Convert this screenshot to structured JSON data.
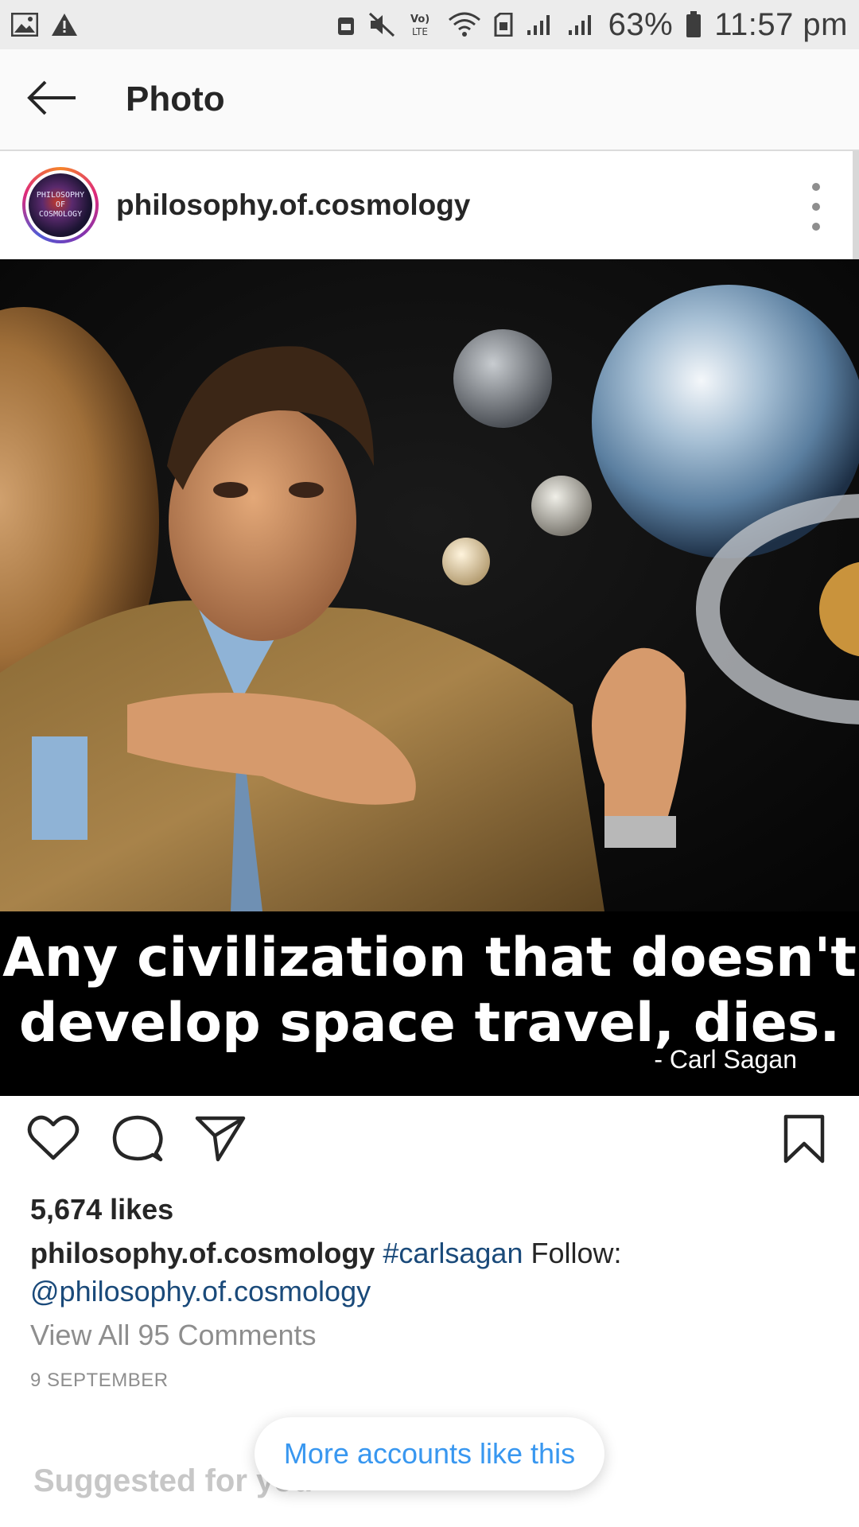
{
  "status_bar": {
    "battery_percent": "63%",
    "time": "11:57 pm",
    "network_label": "LTE"
  },
  "app_bar": {
    "title": "Photo"
  },
  "post": {
    "username": "philosophy.of.cosmology",
    "avatar_text": [
      "PHILOSOPHY",
      "OF",
      "COSMOLOGY"
    ],
    "image": {
      "quote_line1": "Any civilization that doesn't",
      "quote_line2": "develop space travel, dies.",
      "attribution": "- Carl Sagan"
    },
    "likes": "5,674 likes",
    "caption": {
      "user": "philosophy.of.cosmology",
      "hashtag": "#carlsagan",
      "text": "Follow:",
      "mention": "@philosophy.of.cosmology"
    },
    "view_comments": "View All 95 Comments",
    "date": "9 SEPTEMBER"
  },
  "suggested": {
    "title": "Suggested for you",
    "more_accounts_button": "More accounts like this"
  },
  "colors": {
    "link_blue": "#3897f0",
    "tag_blue": "#1a4a7a",
    "muted_gray": "#8e8e8e"
  }
}
